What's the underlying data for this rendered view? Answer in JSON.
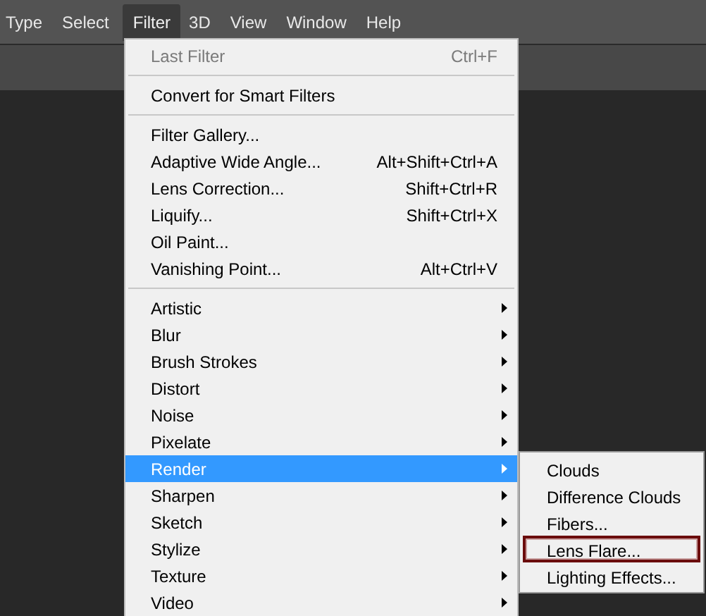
{
  "menu_bar": [
    {
      "label": "Type",
      "selected": false
    },
    {
      "label": "Select",
      "selected": false
    },
    {
      "label": "Filter",
      "selected": true
    },
    {
      "label": "3D",
      "selected": false
    },
    {
      "label": "View",
      "selected": false
    },
    {
      "label": "Window",
      "selected": false
    },
    {
      "label": "Help",
      "selected": false
    }
  ],
  "filter_menu": [
    {
      "kind": "item",
      "label": "Last Filter",
      "shortcut": "Ctrl+F",
      "disabled": true,
      "selected": false
    },
    {
      "kind": "separator"
    },
    {
      "kind": "item",
      "label": "Convert for Smart Filters",
      "disabled": false,
      "selected": false
    },
    {
      "kind": "separator"
    },
    {
      "kind": "item",
      "label": "Filter Gallery...",
      "disabled": false,
      "selected": false
    },
    {
      "kind": "item",
      "label": "Adaptive Wide Angle...",
      "shortcut": "Alt+Shift+Ctrl+A",
      "disabled": false,
      "selected": false
    },
    {
      "kind": "item",
      "label": "Lens Correction...",
      "shortcut": "Shift+Ctrl+R",
      "disabled": false,
      "selected": false
    },
    {
      "kind": "item",
      "label": "Liquify...",
      "shortcut": "Shift+Ctrl+X",
      "disabled": false,
      "selected": false
    },
    {
      "kind": "item",
      "label": "Oil Paint...",
      "disabled": false,
      "selected": false
    },
    {
      "kind": "item",
      "label": "Vanishing Point...",
      "shortcut": "Alt+Ctrl+V",
      "disabled": false,
      "selected": false
    },
    {
      "kind": "separator"
    },
    {
      "kind": "submenu",
      "label": "Artistic",
      "disabled": false,
      "selected": false
    },
    {
      "kind": "submenu",
      "label": "Blur",
      "disabled": false,
      "selected": false
    },
    {
      "kind": "submenu",
      "label": "Brush Strokes",
      "disabled": false,
      "selected": false
    },
    {
      "kind": "submenu",
      "label": "Distort",
      "disabled": false,
      "selected": false
    },
    {
      "kind": "submenu",
      "label": "Noise",
      "disabled": false,
      "selected": false
    },
    {
      "kind": "submenu",
      "label": "Pixelate",
      "disabled": false,
      "selected": false
    },
    {
      "kind": "submenu",
      "label": "Render",
      "disabled": false,
      "selected": true
    },
    {
      "kind": "submenu",
      "label": "Sharpen",
      "disabled": false,
      "selected": false
    },
    {
      "kind": "submenu",
      "label": "Sketch",
      "disabled": false,
      "selected": false
    },
    {
      "kind": "submenu",
      "label": "Stylize",
      "disabled": false,
      "selected": false
    },
    {
      "kind": "submenu",
      "label": "Texture",
      "disabled": false,
      "selected": false
    },
    {
      "kind": "submenu",
      "label": "Video",
      "disabled": false,
      "selected": false
    }
  ],
  "render_submenu": [
    {
      "label": "Clouds",
      "selected": false
    },
    {
      "label": "Difference Clouds",
      "selected": false
    },
    {
      "label": "Fibers...",
      "selected": false
    },
    {
      "label": "Lens Flare...",
      "selected": true
    },
    {
      "label": "Lighting Effects...",
      "selected": false
    }
  ]
}
